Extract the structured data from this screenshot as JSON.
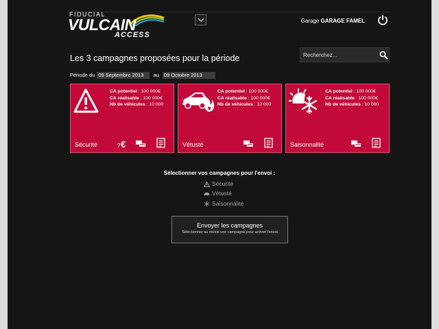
{
  "header": {
    "logo": {
      "brand_top": "FIDUCIAL",
      "brand_main": "VULCAIN",
      "brand_sub": "ACCESS"
    },
    "garage_prefix": "Garage",
    "garage_name": "GARAGE FAMEL",
    "icons": {
      "dropdown": "chevron-down-icon",
      "power": "power-icon"
    }
  },
  "main": {
    "title": "Les 3 campagnes proposées pour la période",
    "search": {
      "placeholder": "Recherchez...",
      "value": ""
    },
    "period": {
      "label": "Période du",
      "start": "09 Septembre 2013",
      "sep": "au",
      "end": "09 Octobre 2013"
    }
  },
  "campaigns": [
    {
      "name": "Sécurité",
      "icon": "warning-icon",
      "ca_potentiel_label": "CA potentiel",
      "ca_potentiel": ": 100 000€",
      "ca_realisable_label": "CA réalisable",
      "ca_realisable": ": 100 000€",
      "nb_vehicules_label": "Nb de véhicules",
      "nb_vehicules": ": 10 000"
    },
    {
      "name": "Vétusté",
      "icon": "car-fire-icon",
      "ca_potentiel_label": "CA potentiel",
      "ca_potentiel": ": 100 000€",
      "ca_realisable_label": "CA réalisable",
      "ca_realisable": ": 100 000€",
      "nb_vehicules_label": "Nb de véhicules",
      "nb_vehicules": ": 10 000"
    },
    {
      "name": "Saisonnalité",
      "icon": "sun-snowflake-icon",
      "ca_potentiel_label": "CA potentiel",
      "ca_potentiel": ": 100 000€",
      "ca_realisable_label": "CA réalisable",
      "ca_realisable": ": 100 000€",
      "nb_vehicules_label": "Nb de véhicules",
      "nb_vehicules": ": 10 000"
    }
  ],
  "selection": {
    "title": "Sélectionner vos campagnes pour l'envoi :",
    "options": [
      "Sécurité",
      "Vétusté",
      "Saisonnalité"
    ]
  },
  "send_button": {
    "label": "Envoyer les campagnes",
    "hint": "Sélectionner au moins une campagne pour activer l'envoi"
  },
  "colors": {
    "card": "#c3093a",
    "background": "#151515",
    "page": "#dcdcdc"
  }
}
